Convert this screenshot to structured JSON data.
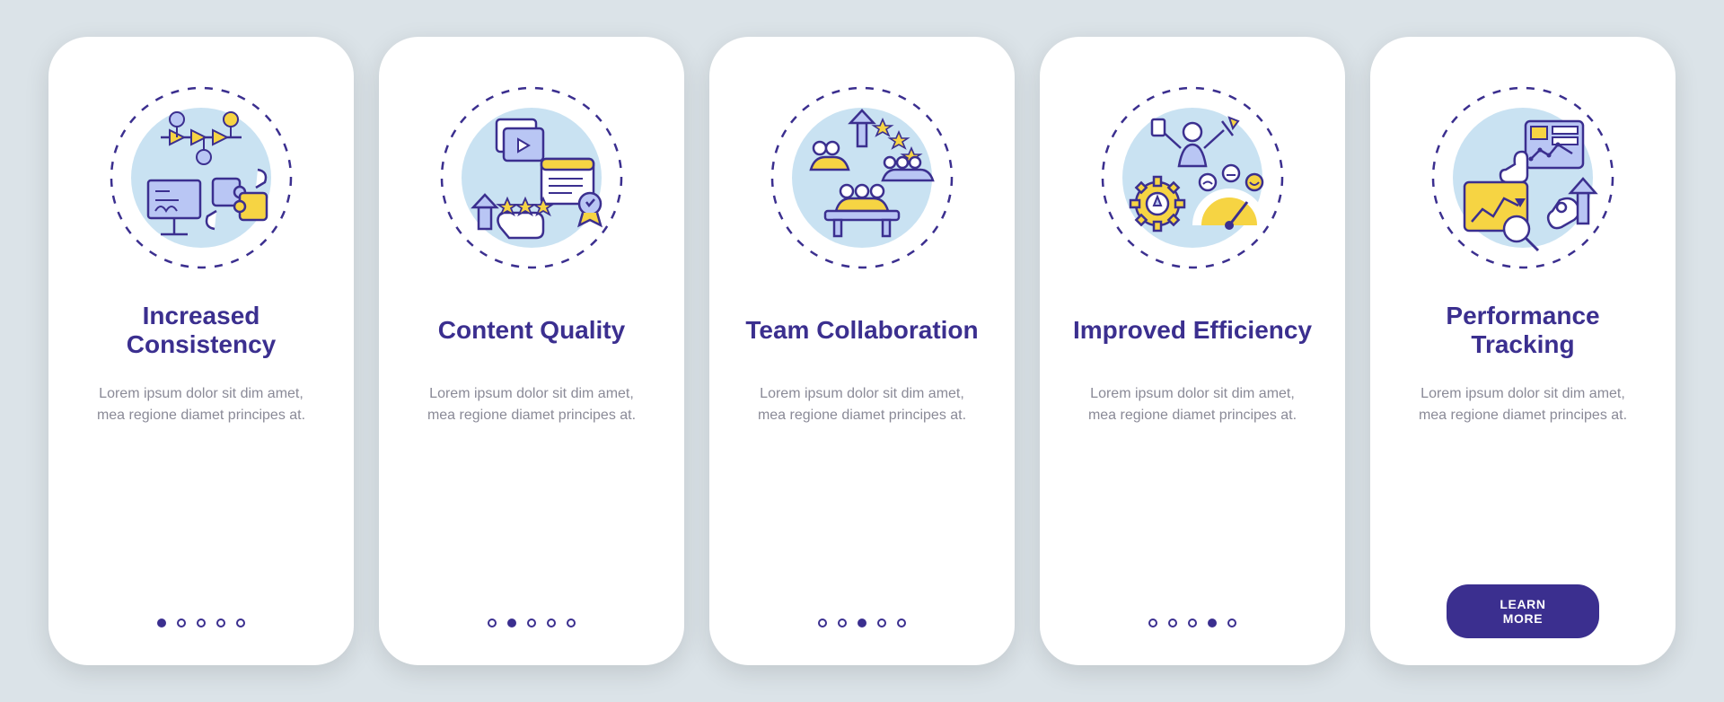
{
  "colors": {
    "primary": "#3b2f8f",
    "accentLight": "#b9c6f4",
    "accentYellow": "#f6d443",
    "bgCircle": "#c9e2f2"
  },
  "placeholderBody": "Lorem ipsum dolor sit dim amet, mea regione diamet principes at.",
  "ctaLabel": "LEARN MORE",
  "slides": [
    {
      "id": "increased-consistency",
      "title": "Increased Consistency",
      "icon": "consistency-icon",
      "activeDot": 0,
      "hasCta": false
    },
    {
      "id": "content-quality",
      "title": "Content Quality",
      "icon": "quality-icon",
      "activeDot": 1,
      "hasCta": false
    },
    {
      "id": "team-collaboration",
      "title": "Team Collaboration",
      "icon": "collaboration-icon",
      "activeDot": 2,
      "hasCta": false
    },
    {
      "id": "improved-efficiency",
      "title": "Improved Efficiency",
      "icon": "efficiency-icon",
      "activeDot": 3,
      "hasCta": false
    },
    {
      "id": "performance-tracking",
      "title": "Performance Tracking",
      "icon": "tracking-icon",
      "activeDot": 4,
      "hasCta": true
    }
  ],
  "dotCount": 5
}
